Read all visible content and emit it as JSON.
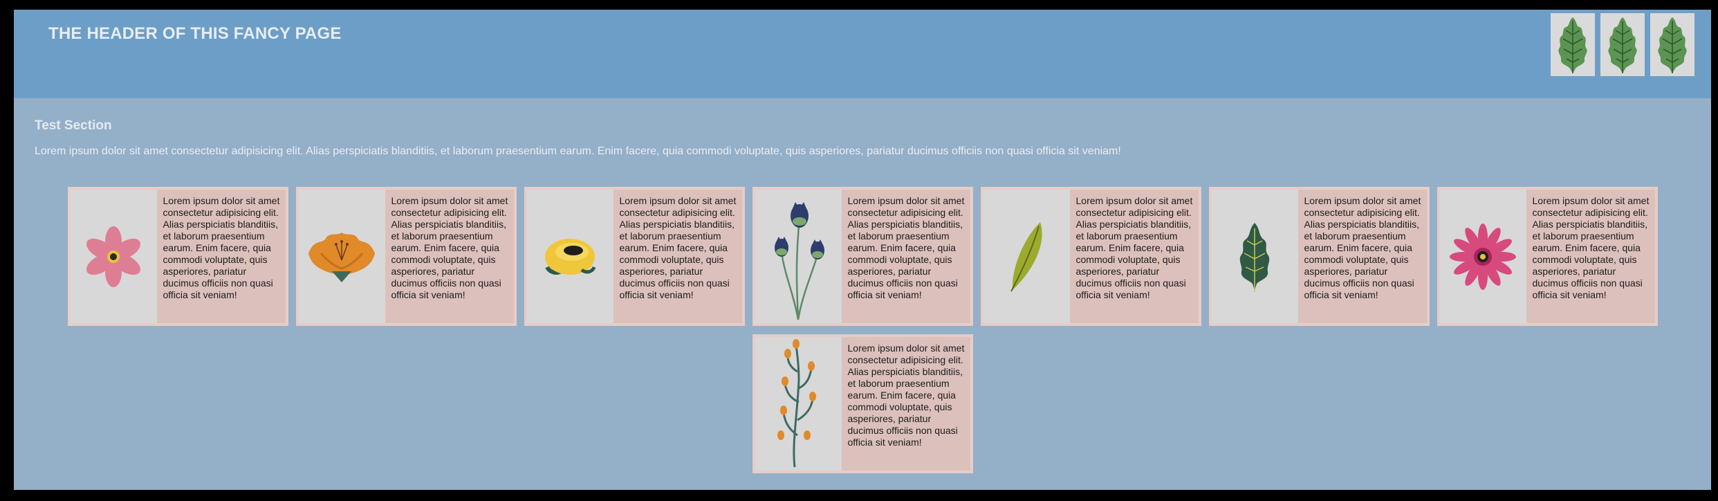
{
  "header": {
    "title": "THE HEADER OF THIS FANCY PAGE",
    "icons": [
      "oak-leaf-icon",
      "oak-leaf-icon",
      "oak-leaf-icon"
    ]
  },
  "section": {
    "title": "Test Section",
    "text": "Lorem ipsum dolor sit amet consectetur adipisicing elit. Alias perspiciatis blanditiis, et laborum praesentium earum. Enim facere, quia commodi voluptate, quis asperiores, pariatur ducimus officiis non quasi officia sit veniam!"
  },
  "cards": [
    {
      "image": "pink-flower-icon",
      "text": "Lorem ipsum dolor sit amet consectetur adipisicing elit. Alias perspiciatis blanditiis, et laborum praesentium earum. Enim facere, quia commodi voluptate, quis asperiores, pariatur ducimus officiis non quasi officia sit veniam!"
    },
    {
      "image": "orange-flower-icon",
      "text": "Lorem ipsum dolor sit amet consectetur adipisicing elit. Alias perspiciatis blanditiis, et laborum praesentium earum. Enim facere, quia commodi voluptate, quis asperiores, pariatur ducimus officiis non quasi officia sit veniam!"
    },
    {
      "image": "yellow-flower-icon",
      "text": "Lorem ipsum dolor sit amet consectetur adipisicing elit. Alias perspiciatis blanditiis, et laborum praesentium earum. Enim facere, quia commodi voluptate, quis asperiores, pariatur ducimus officiis non quasi officia sit veniam!"
    },
    {
      "image": "thistle-flowers-icon",
      "text": "Lorem ipsum dolor sit amet consectetur adipisicing elit. Alias perspiciatis blanditiis, et laborum praesentium earum. Enim facere, quia commodi voluptate, quis asperiores, pariatur ducimus officiis non quasi officia sit veniam!"
    },
    {
      "image": "olive-leaf-icon",
      "text": "Lorem ipsum dolor sit amet consectetur adipisicing elit. Alias perspiciatis blanditiis, et laborum praesentium earum. Enim facere, quia commodi voluptate, quis asperiores, pariatur ducimus officiis non quasi officia sit veniam!"
    },
    {
      "image": "green-leaf-icon",
      "text": "Lorem ipsum dolor sit amet consectetur adipisicing elit. Alias perspiciatis blanditiis, et laborum praesentium earum. Enim facere, quia commodi voluptate, quis asperiores, pariatur ducimus officiis non quasi officia sit veniam!"
    },
    {
      "image": "magenta-flower-icon",
      "text": "Lorem ipsum dolor sit amet consectetur adipisicing elit. Alias perspiciatis blanditiis, et laborum praesentium earum. Enim facere, quia commodi voluptate, quis asperiores, pariatur ducimus officiis non quasi officia sit veniam!"
    },
    {
      "image": "berry-branch-icon",
      "text": "Lorem ipsum dolor sit amet consectetur adipisicing elit. Alias perspiciatis blanditiis, et laborum praesentium earum. Enim facere, quia commodi voluptate, quis asperiores, pariatur ducimus officiis non quasi officia sit veniam!"
    }
  ],
  "colors": {
    "header_bg": "#6d9ec7",
    "page_bg": "#94afc8",
    "card_text_bg": "#dcc0bc",
    "card_image_bg": "#d8d8d8"
  }
}
